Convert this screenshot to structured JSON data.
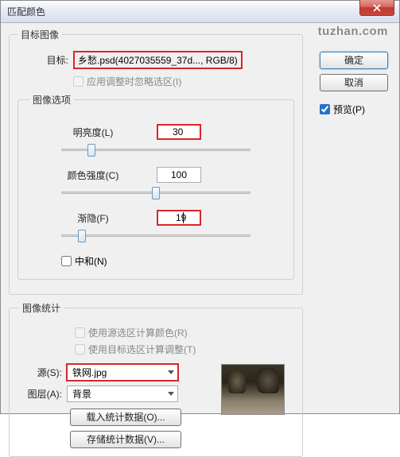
{
  "window": {
    "title": "匹配颜色"
  },
  "watermark": "tuzhan.com",
  "buttons": {
    "ok": "确定",
    "cancel": "取消"
  },
  "preview": {
    "label": "预览(P)",
    "checked": true
  },
  "target_image": {
    "legend": "目标图像",
    "target_label": "目标:",
    "target_value": "乡愁.psd(4027035559_37d..., RGB/8)",
    "ignore_sel_label": "应用调整时忽略选区(I)"
  },
  "image_options": {
    "legend": "图像选项",
    "luminance": {
      "label": "明亮度(L)",
      "value": "30",
      "pos": 14
    },
    "intensity": {
      "label": "颜色强度(C)",
      "value": "100",
      "pos": 48
    },
    "fade": {
      "label": "渐隐(F)",
      "value": "19",
      "pos": 9
    },
    "neutralize_label": "中和(N)"
  },
  "image_stats": {
    "legend": "图像统计",
    "use_src_sel": "使用源选区计算颜色(R)",
    "use_tgt_sel": "使用目标选区计算调整(T)",
    "source_label": "源(S):",
    "source_value": "铁网.jpg",
    "layer_label": "图层(A):",
    "layer_value": "背景",
    "load_btn": "载入统计数据(O)...",
    "save_btn": "存储统计数据(V)..."
  }
}
